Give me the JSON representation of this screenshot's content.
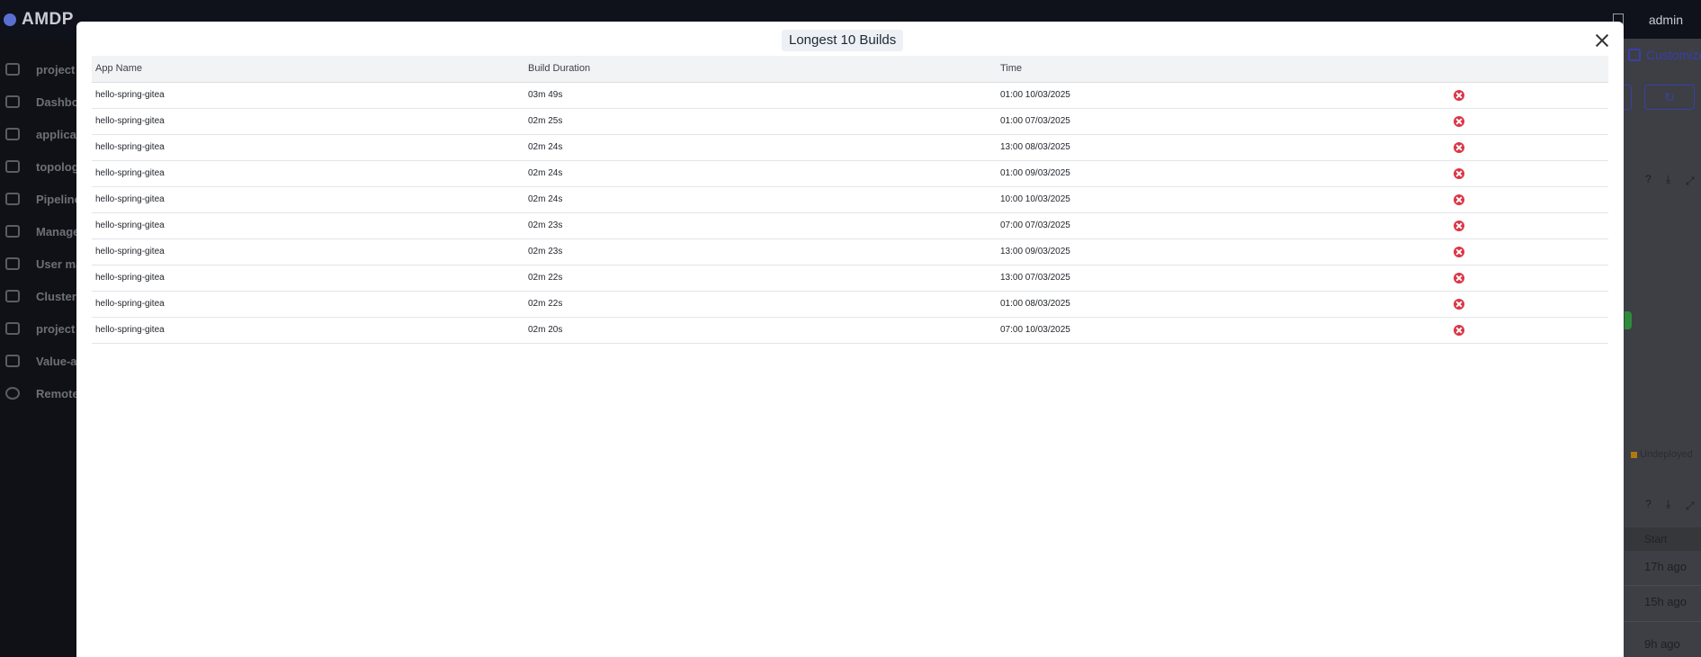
{
  "app": {
    "logo_text": "AMDP",
    "user": "admin"
  },
  "sidebar": {
    "items": [
      {
        "label": "project",
        "icon": "folder-icon"
      },
      {
        "label": "Dashbo",
        "icon": "dashboard-icon"
      },
      {
        "label": "applicati",
        "icon": "atom-icon"
      },
      {
        "label": "topology",
        "icon": "topology-icon"
      },
      {
        "label": "Pipeline",
        "icon": "pipeline-icon"
      },
      {
        "label": "Manage",
        "icon": "users-icon"
      },
      {
        "label": "User ma",
        "icon": "user-settings-icon"
      },
      {
        "label": "Cluster M",
        "icon": "server-icon"
      },
      {
        "label": "project m",
        "icon": "folder-icon"
      },
      {
        "label": "Value-ad",
        "icon": "puzzle-icon"
      },
      {
        "label": "Remote",
        "icon": "circle-icon"
      }
    ]
  },
  "background": {
    "customize_label": "Customize",
    "legend_undeployed": "Undeployed",
    "start_header": "Start",
    "times_ago": [
      "17h ago",
      "15h ago",
      "9h ago"
    ]
  },
  "modal": {
    "title": "Longest 10 Builds",
    "columns": [
      "App Name",
      "Build Duration",
      "Time",
      ""
    ],
    "rows": [
      {
        "app": "hello-spring-gitea",
        "duration": "03m 49s",
        "time": "01:00 10/03/2025",
        "status": "failed"
      },
      {
        "app": "hello-spring-gitea",
        "duration": "02m 25s",
        "time": "01:00 07/03/2025",
        "status": "failed"
      },
      {
        "app": "hello-spring-gitea",
        "duration": "02m 24s",
        "time": "13:00 08/03/2025",
        "status": "failed"
      },
      {
        "app": "hello-spring-gitea",
        "duration": "02m 24s",
        "time": "01:00 09/03/2025",
        "status": "failed"
      },
      {
        "app": "hello-spring-gitea",
        "duration": "02m 24s",
        "time": "10:00 10/03/2025",
        "status": "failed"
      },
      {
        "app": "hello-spring-gitea",
        "duration": "02m 23s",
        "time": "07:00 07/03/2025",
        "status": "failed"
      },
      {
        "app": "hello-spring-gitea",
        "duration": "02m 23s",
        "time": "13:00 09/03/2025",
        "status": "failed"
      },
      {
        "app": "hello-spring-gitea",
        "duration": "02m 22s",
        "time": "13:00 07/03/2025",
        "status": "failed"
      },
      {
        "app": "hello-spring-gitea",
        "duration": "02m 22s",
        "time": "01:00 08/03/2025",
        "status": "failed"
      },
      {
        "app": "hello-spring-gitea",
        "duration": "02m 20s",
        "time": "07:00 10/03/2025",
        "status": "failed"
      }
    ]
  },
  "colors": {
    "error": "#dc3545",
    "accent": "#3b3fa8"
  }
}
